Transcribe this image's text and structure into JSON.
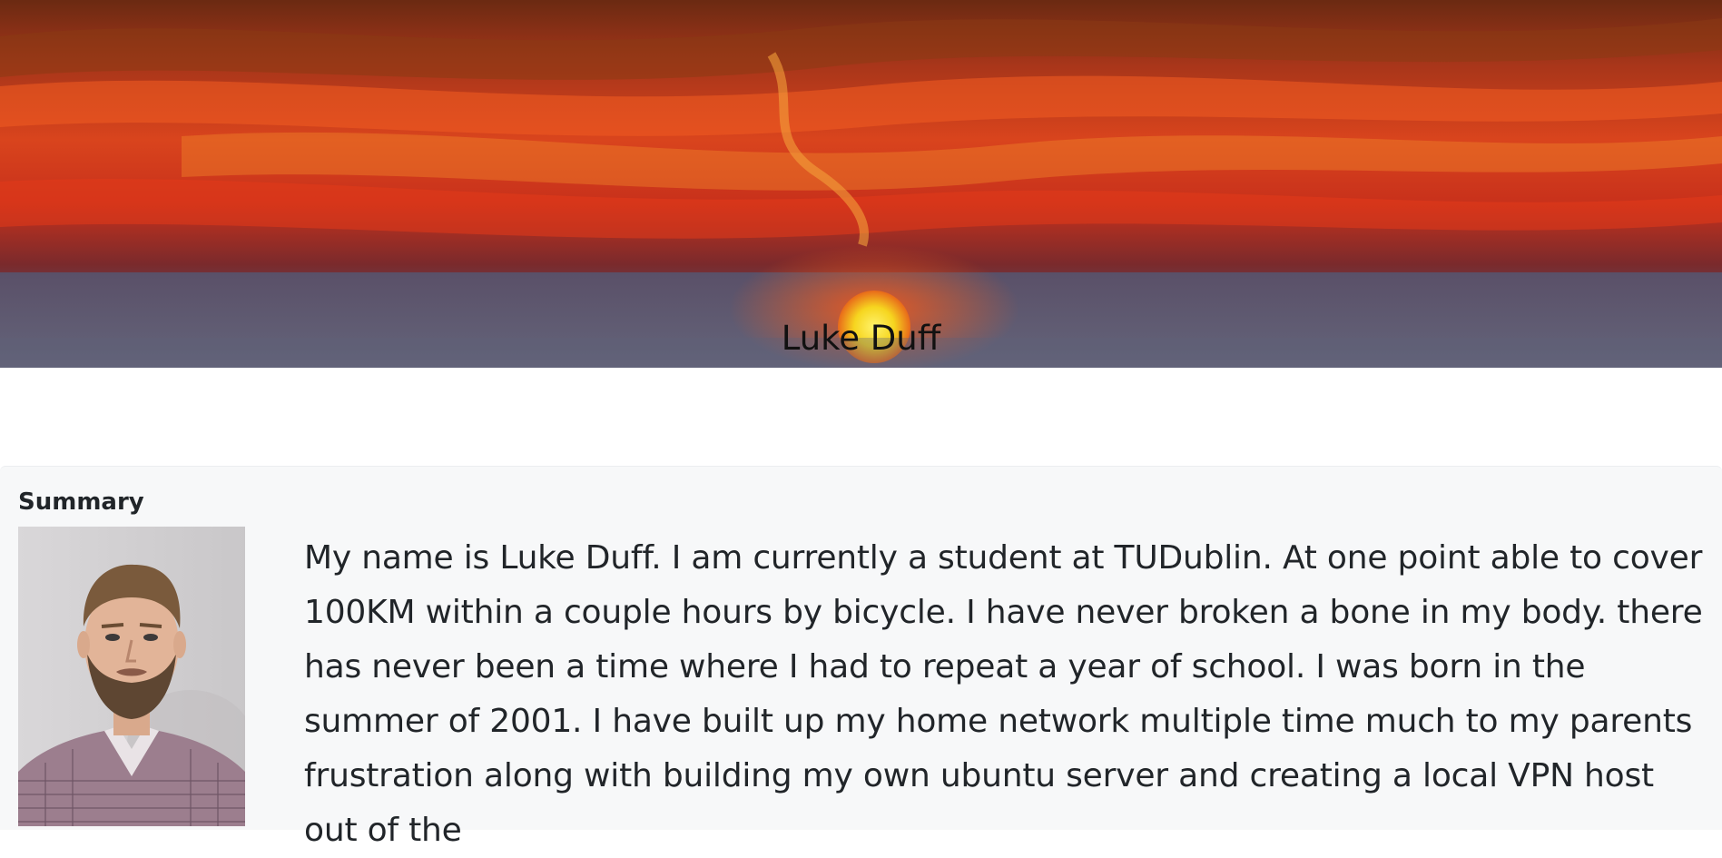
{
  "hero": {
    "name": "Luke Duff",
    "background_image": "sunset-over-sea"
  },
  "summary": {
    "heading": "Summary",
    "photo": "profile-photo-of-luke-duff",
    "text": "My name is Luke Duff. I am currently a student at TUDublin. At one point able to cover 100KM within a couple hours by bicycle. I have never broken a bone in my body. there has never been a time where I had to repeat a year of school. I was born in the summer of 2001. I have built up my home network multiple time much to my parents frustration along with building my own ubuntu server and creating a local VPN host out of the"
  },
  "colors": {
    "summary_background": "#f7f8f9",
    "text": "#212529",
    "sky_orange": "#e8481e",
    "sun": "#f6e22a",
    "sea": "#5f5f78"
  }
}
